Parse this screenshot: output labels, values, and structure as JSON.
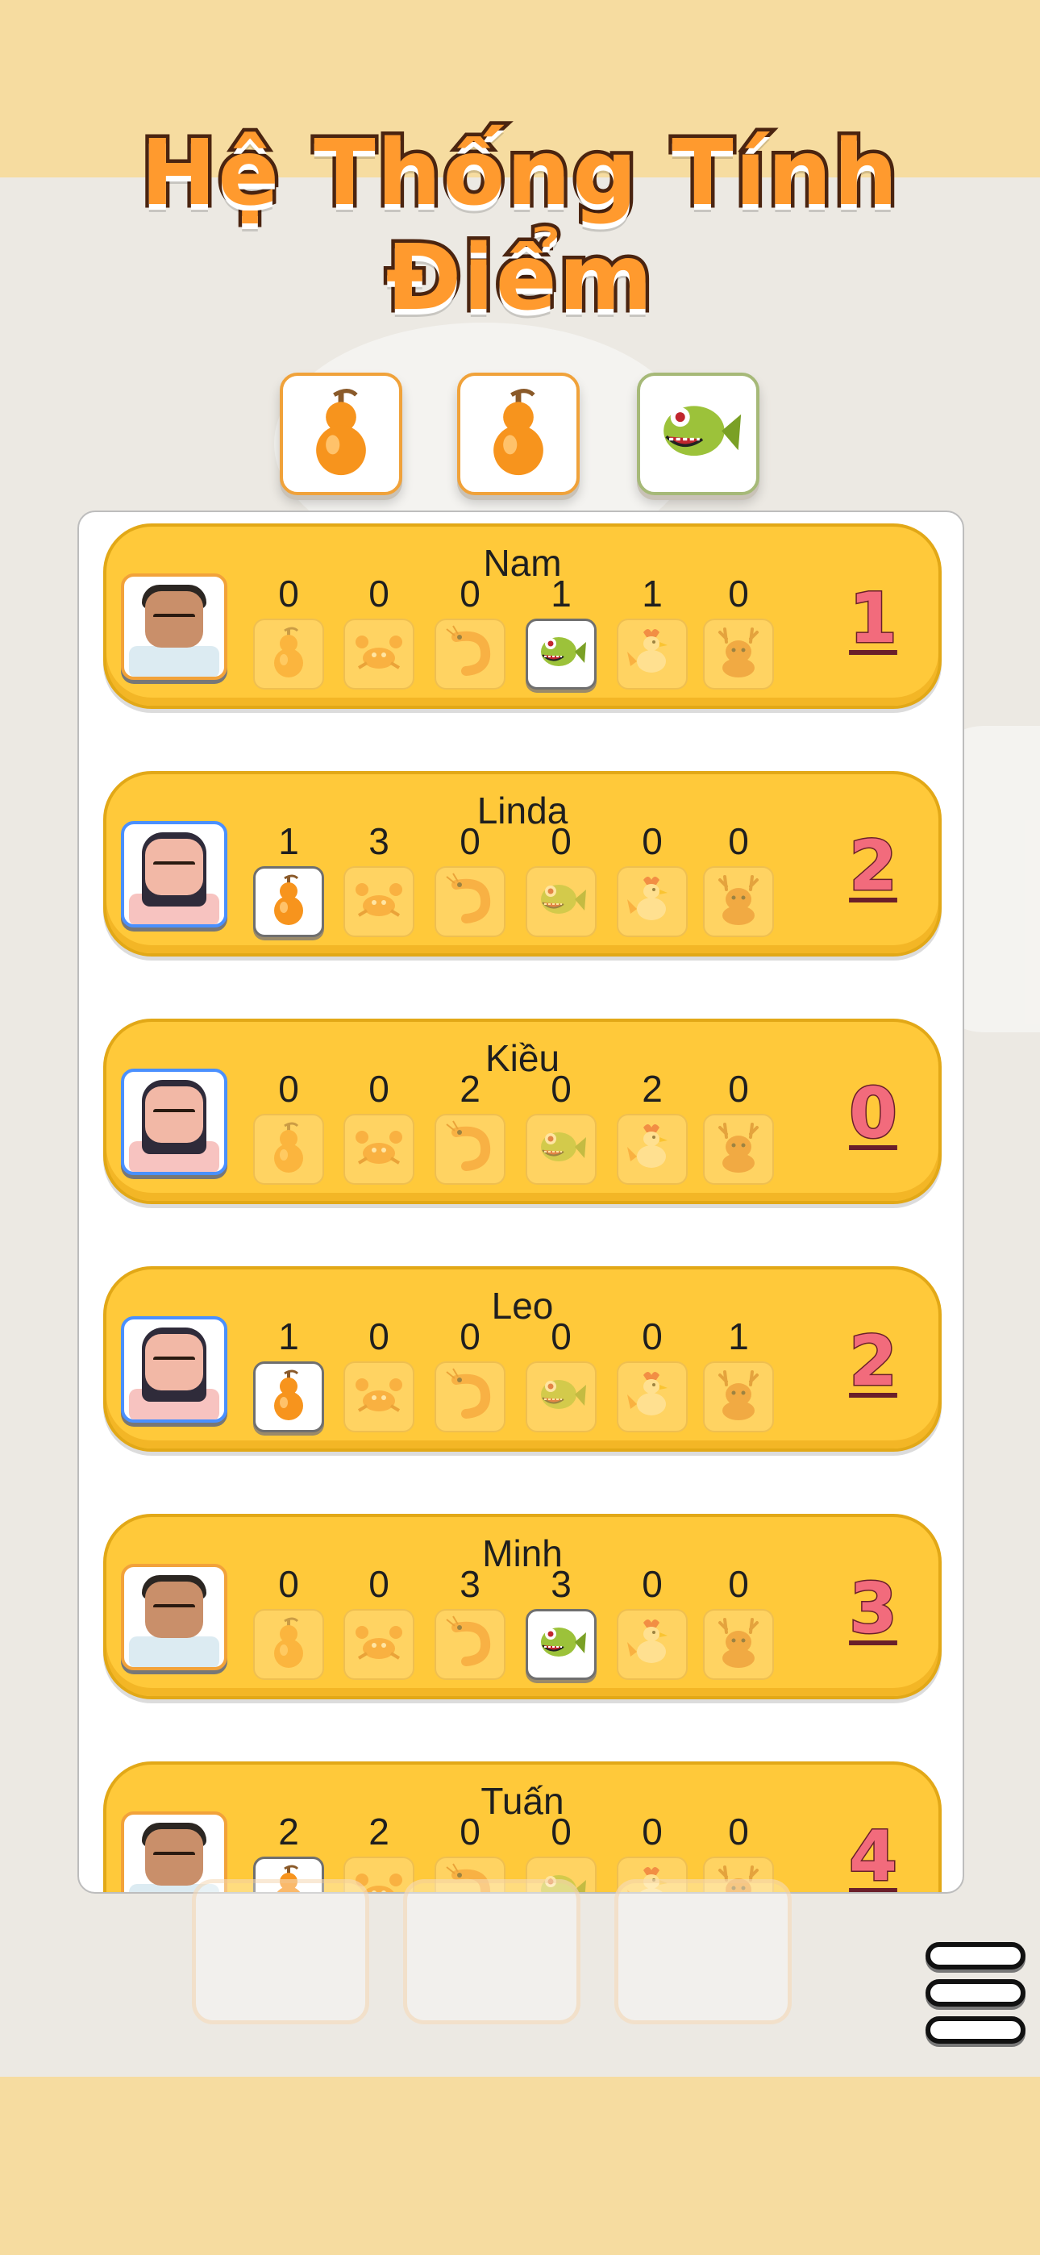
{
  "title": "Hệ Thống Tính Điểm",
  "icons": [
    "gourd-icon",
    "crab-icon",
    "shrimp-icon",
    "fish-icon",
    "rooster-icon",
    "deer-icon"
  ],
  "dice": [
    {
      "icon": "gourd-icon"
    },
    {
      "icon": "gourd-icon"
    },
    {
      "icon": "fish-icon"
    }
  ],
  "players": [
    {
      "name": "Nam",
      "avatar": "boy",
      "counts": [
        "0",
        "0",
        "0",
        "1",
        "1",
        "0"
      ],
      "active": [
        false,
        false,
        false,
        true,
        false,
        false
      ],
      "score": "1"
    },
    {
      "name": "Linda",
      "avatar": "girl",
      "counts": [
        "1",
        "3",
        "0",
        "0",
        "0",
        "0"
      ],
      "active": [
        true,
        false,
        false,
        false,
        false,
        false
      ],
      "score": "2"
    },
    {
      "name": "Kiều",
      "avatar": "girl",
      "counts": [
        "0",
        "0",
        "2",
        "0",
        "2",
        "0"
      ],
      "active": [
        false,
        false,
        false,
        false,
        false,
        false
      ],
      "score": "0"
    },
    {
      "name": "Leo",
      "avatar": "girl",
      "counts": [
        "1",
        "0",
        "0",
        "0",
        "0",
        "1"
      ],
      "active": [
        true,
        false,
        false,
        false,
        false,
        false
      ],
      "score": "2"
    },
    {
      "name": "Minh",
      "avatar": "boy",
      "counts": [
        "0",
        "0",
        "3",
        "3",
        "0",
        "0"
      ],
      "active": [
        false,
        false,
        false,
        true,
        false,
        false
      ],
      "score": "3"
    },
    {
      "name": "Tuấn",
      "avatar": "boy",
      "counts": [
        "2",
        "2",
        "0",
        "0",
        "0",
        "0"
      ],
      "active": [
        true,
        false,
        false,
        false,
        false,
        false
      ],
      "score": "4"
    }
  ],
  "colors": {
    "accent": "#ff9a2e",
    "pill": "#ffc93a",
    "score": "#f26b7c",
    "background": "#f6dca0"
  }
}
